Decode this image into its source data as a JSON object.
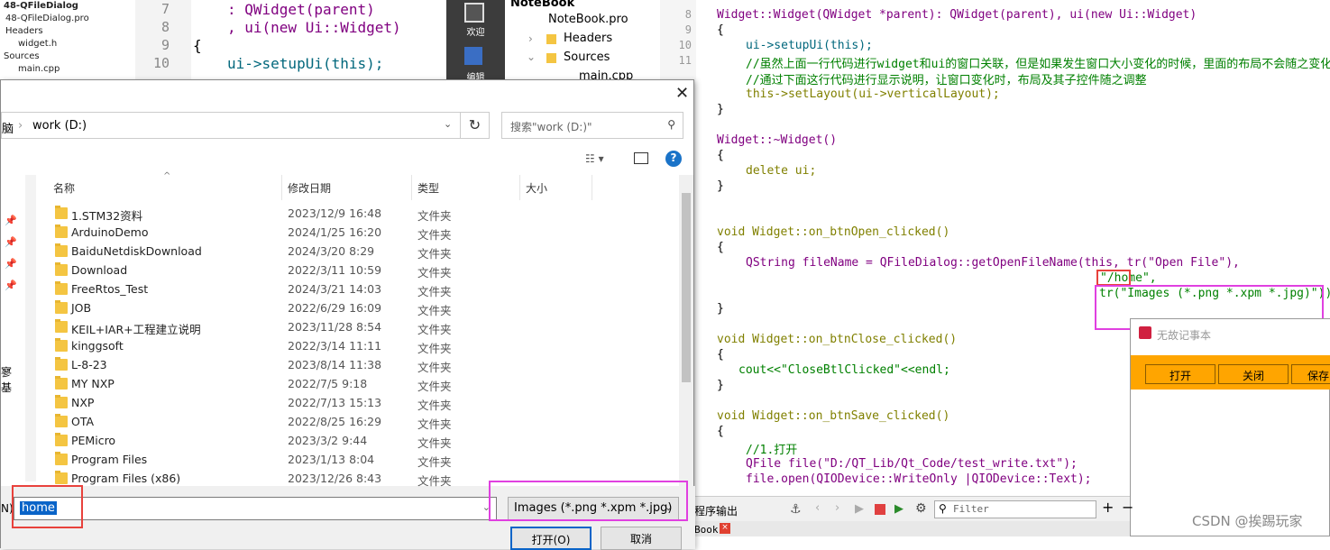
{
  "left_tree": {
    "project": "48-QFileDialog",
    "pro_file": "48-QFileDialog.pro",
    "headers": "Headers",
    "header_file": "widget.h",
    "sources": "Sources",
    "source_file": "main.cpp"
  },
  "left_code": {
    "line_numbers": [
      "7",
      "8",
      "9",
      "10"
    ],
    "lines": [
      ": QWidget(parent)",
      ", ui(new Ui::Widget)",
      "{",
      "ui->setupUi(this);"
    ]
  },
  "qt_sidebar": {
    "welcome": "欢迎",
    "edit": "编辑"
  },
  "project_tree": {
    "root": "NoteBook",
    "pro": "NoteBook.pro",
    "headers": "Headers",
    "sources": "Sources",
    "main": "main.cpp"
  },
  "right_code": {
    "line_numbers": [
      "8",
      "9",
      "10",
      "11"
    ],
    "ctor": "Widget::Widget(QWidget *parent): QWidget(parent), ui(new Ui::Widget)",
    "setup": "ui->setupUi(this);",
    "comment1": "//虽然上面一行代码进行widget和ui的窗口关联，但是如果发生窗口大小变化的时候，里面的布局不会随之变化",
    "comment2": "//通过下面这行代码进行显示说明，让窗口变化时，布局及其子控件随之调整",
    "layout": "this->setLayout(ui->verticalLayout);",
    "dtor": "Widget::~Widget()",
    "delete": "delete ui;",
    "open_fn": "void Widget::on_btnOpen_clicked()",
    "getfile": "QString fileName = QFileDialog::getOpenFileName(this, tr(\"Open File\"),",
    "home": "\"/home\",",
    "images": "tr(\"Images (*.png *.xpm *.jpg)\"));",
    "close_fn": "void Widget::on_btnClose_clicked()",
    "cout": "cout<<\"CloseBtlClicked\"<<endl;",
    "save_fn": "void Widget::on_btnSave_clicked()",
    "c_open": "//1.打开",
    "qfile": "QFile file(\"D:/QT_Lib/Qt_Code/test_write.txt\");",
    "fopen": "file.open(QIODevice::WriteOnly |QIODevice::Text);"
  },
  "dialog": {
    "address": "work (D:)",
    "search_placeholder": "搜索\"work (D:)\"",
    "columns": {
      "name": "名称",
      "date": "修改日期",
      "type": "类型",
      "size": "大小"
    },
    "files": [
      {
        "name": "1.STM32资料",
        "date": "2023/12/9 16:48",
        "type": "文件夹"
      },
      {
        "name": "ArduinoDemo",
        "date": "2024/1/25 16:20",
        "type": "文件夹"
      },
      {
        "name": "BaiduNetdiskDownload",
        "date": "2024/3/20 8:29",
        "type": "文件夹"
      },
      {
        "name": "Download",
        "date": "2022/3/11 10:59",
        "type": "文件夹"
      },
      {
        "name": "FreeRtos_Test",
        "date": "2024/3/21 14:03",
        "type": "文件夹"
      },
      {
        "name": "JOB",
        "date": "2022/6/29 16:09",
        "type": "文件夹"
      },
      {
        "name": "KEIL+IAR+工程建立说明",
        "date": "2023/11/28 8:54",
        "type": "文件夹"
      },
      {
        "name": "kinggsoft",
        "date": "2022/3/14 11:11",
        "type": "文件夹"
      },
      {
        "name": "L-8-23",
        "date": "2023/8/14 11:38",
        "type": "文件夹"
      },
      {
        "name": "MY NXP",
        "date": "2022/7/5 9:18",
        "type": "文件夹"
      },
      {
        "name": "NXP",
        "date": "2022/7/13 15:13",
        "type": "文件夹"
      },
      {
        "name": "OTA",
        "date": "2022/8/25 16:29",
        "type": "文件夹"
      },
      {
        "name": "PEMicro",
        "date": "2023/3/2 9:44",
        "type": "文件夹"
      },
      {
        "name": "Program Files",
        "date": "2023/1/13 8:04",
        "type": "文件夹"
      },
      {
        "name": "Program Files (x86)",
        "date": "2023/12/26 8:43",
        "type": "文件夹"
      }
    ],
    "filename_label": "N):",
    "filename_value": "home",
    "filter_value": "Images (*.png *.xpm *.jpg)",
    "open_button": "打开(O)",
    "cancel_button": "取消",
    "nav_partial": "寥基",
    "addr_prefix": "脑"
  },
  "notepad": {
    "title": "无故记事本",
    "open": "打开",
    "close": "关闭",
    "save": "保存"
  },
  "output": {
    "label": "程序输出",
    "filter_placeholder": "Filter",
    "tab": "Book"
  },
  "watermark": "CSDN @挨踢玩家"
}
